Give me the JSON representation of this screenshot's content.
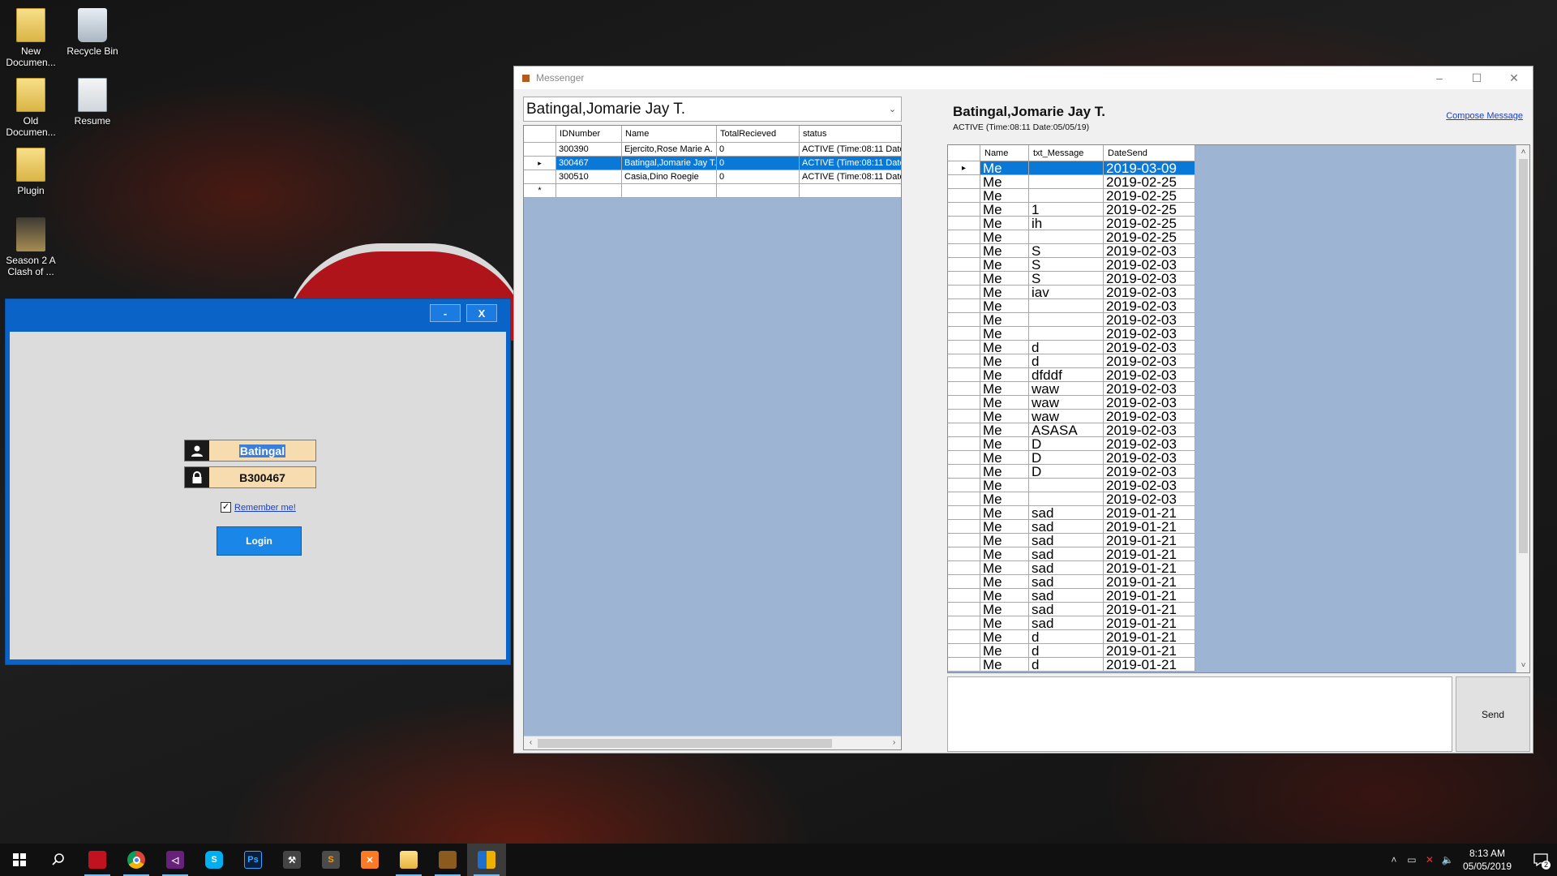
{
  "desktop": {
    "icons": [
      {
        "label": "New\nDocumen...",
        "glyph": "folder-icon"
      },
      {
        "label": "Recycle Bin",
        "glyph": "recycle-bin-icon"
      },
      {
        "label": "Old\nDocumen...",
        "glyph": "folder-icon"
      },
      {
        "label": "Resume",
        "glyph": "document-icon"
      },
      {
        "label": "Plugin",
        "glyph": "folder-icon"
      },
      {
        "label": "Season 2 A\nClash of ...",
        "glyph": "game-shortcut-icon"
      }
    ]
  },
  "login": {
    "minimize_label": "-",
    "close_label": "X",
    "username_value": "Batingal",
    "password_value": "B300467",
    "remember_label": "Remember me!",
    "remember_checked": true,
    "login_label": "Login",
    "accent_color": "#0a64c8",
    "field_color": "#f6dcaf"
  },
  "messenger": {
    "title": "Messenger",
    "minimize_label": "–",
    "maximize_label": "☐",
    "close_label": "✕",
    "contact_combo_value": "Batingal,Jomarie Jay T.",
    "users_grid": {
      "columns": [
        "IDNumber",
        "Name",
        "TotalRecieved",
        "status"
      ],
      "rows": [
        {
          "id": "300390",
          "name": "Ejercito,Rose Marie  A.",
          "total": "0",
          "status": "ACTIVE  (Time:08:11 Date"
        },
        {
          "id": "300467",
          "name": "Batingal,Jomarie Jay T.",
          "total": "0",
          "status": "ACTIVE  (Time:08:11 Date"
        },
        {
          "id": "300510",
          "name": "Casia,Dino Roegie",
          "total": "0",
          "status": "ACTIVE  (Time:08:11 Date"
        }
      ],
      "selected_index": 1,
      "new_row_marker": "*",
      "current_row_marker": "▸"
    },
    "contact": {
      "name": "Batingal,Jomarie Jay T.",
      "status": "ACTIVE  (Time:08:11 Date:05/05/19)"
    },
    "compose_label": "Compose Message",
    "messages_grid": {
      "columns": [
        "Name",
        "txt_Message",
        "DateSend"
      ],
      "selected_index": 0,
      "current_row_marker": "▸",
      "rows": [
        {
          "name": "Me",
          "msg": "",
          "date": "2019-03-09"
        },
        {
          "name": "Me",
          "msg": "",
          "date": "2019-02-25"
        },
        {
          "name": "Me",
          "msg": "",
          "date": "2019-02-25"
        },
        {
          "name": "Me",
          "msg": "1",
          "date": "2019-02-25"
        },
        {
          "name": "Me",
          "msg": "ih",
          "date": "2019-02-25"
        },
        {
          "name": "Me",
          "msg": "",
          "date": "2019-02-25"
        },
        {
          "name": "Me",
          "msg": "S",
          "date": "2019-02-03"
        },
        {
          "name": "Me",
          "msg": "S",
          "date": "2019-02-03"
        },
        {
          "name": "Me",
          "msg": "S",
          "date": "2019-02-03"
        },
        {
          "name": "Me",
          "msg": "iav",
          "date": "2019-02-03"
        },
        {
          "name": "Me",
          "msg": "",
          "date": "2019-02-03"
        },
        {
          "name": "Me",
          "msg": "",
          "date": "2019-02-03"
        },
        {
          "name": "Me",
          "msg": "",
          "date": "2019-02-03"
        },
        {
          "name": "Me",
          "msg": "d",
          "date": "2019-02-03"
        },
        {
          "name": "Me",
          "msg": "d",
          "date": "2019-02-03"
        },
        {
          "name": "Me",
          "msg": "dfddf",
          "date": "2019-02-03"
        },
        {
          "name": "Me",
          "msg": "waw",
          "date": "2019-02-03"
        },
        {
          "name": "Me",
          "msg": "waw",
          "date": "2019-02-03"
        },
        {
          "name": "Me",
          "msg": "waw",
          "date": "2019-02-03"
        },
        {
          "name": "Me",
          "msg": "ASASA",
          "date": "2019-02-03"
        },
        {
          "name": "Me",
          "msg": "D",
          "date": "2019-02-03"
        },
        {
          "name": "Me",
          "msg": "D",
          "date": "2019-02-03"
        },
        {
          "name": "Me",
          "msg": "D",
          "date": "2019-02-03"
        },
        {
          "name": "Me",
          "msg": "",
          "date": "2019-02-03"
        },
        {
          "name": "Me",
          "msg": "",
          "date": "2019-02-03"
        },
        {
          "name": "Me",
          "msg": "sad",
          "date": "2019-01-21"
        },
        {
          "name": "Me",
          "msg": "sad",
          "date": "2019-01-21"
        },
        {
          "name": "Me",
          "msg": "sad",
          "date": "2019-01-21"
        },
        {
          "name": "Me",
          "msg": "sad",
          "date": "2019-01-21"
        },
        {
          "name": "Me",
          "msg": "sad",
          "date": "2019-01-21"
        },
        {
          "name": "Me",
          "msg": "sad",
          "date": "2019-01-21"
        },
        {
          "name": "Me",
          "msg": "sad",
          "date": "2019-01-21"
        },
        {
          "name": "Me",
          "msg": "sad",
          "date": "2019-01-21"
        },
        {
          "name": "Me",
          "msg": "sad",
          "date": "2019-01-21"
        },
        {
          "name": "Me",
          "msg": "d",
          "date": "2019-01-21"
        },
        {
          "name": "Me",
          "msg": "d",
          "date": "2019-01-21"
        },
        {
          "name": "Me",
          "msg": "d",
          "date": "2019-01-21"
        }
      ]
    },
    "message_input_value": "",
    "send_label": "Send",
    "selection_color": "#0a78d7",
    "grid_background": "#9db5d3"
  },
  "taskbar": {
    "apps": [
      {
        "name": "start-button",
        "glyph": "windows-logo-icon"
      },
      {
        "name": "search-button",
        "glyph": "search-icon"
      },
      {
        "name": "taskbar-app-red",
        "glyph": "app-icon"
      },
      {
        "name": "taskbar-chrome",
        "glyph": "chrome-icon"
      },
      {
        "name": "taskbar-visual-studio",
        "glyph": "visual-studio-icon"
      },
      {
        "name": "taskbar-skype",
        "glyph": "skype-icon"
      },
      {
        "name": "taskbar-photoshop",
        "glyph": "photoshop-icon"
      },
      {
        "name": "taskbar-tools",
        "glyph": "tools-icon"
      },
      {
        "name": "taskbar-sublime",
        "glyph": "sublime-icon"
      },
      {
        "name": "taskbar-xampp",
        "glyph": "xampp-icon"
      },
      {
        "name": "taskbar-file-explorer",
        "glyph": "folder-icon"
      },
      {
        "name": "taskbar-login-app",
        "glyph": "app-icon"
      },
      {
        "name": "taskbar-messenger",
        "glyph": "messenger-icon"
      }
    ],
    "time": "8:13 AM",
    "date": "05/05/2019",
    "notification_count": "2"
  }
}
